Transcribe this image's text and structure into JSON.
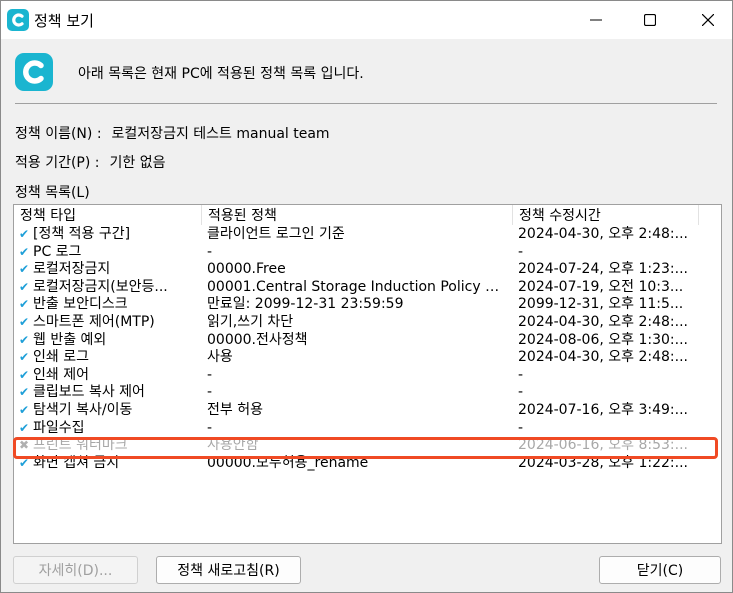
{
  "window": {
    "title": "정책 보기"
  },
  "intro": "아래 목록은 현재 PC에 적용된 정책 목록 입니다.",
  "fields": {
    "name_label": "정책 이름(N) :",
    "name_value": "로컬저장금지 테스트 manual team",
    "period_label": "적용 기간(P) :",
    "period_value": "기한 없음",
    "list_label": "정책 목록(L)"
  },
  "list": {
    "columns": [
      "정책 타입",
      "적용된 정책",
      "정책 수정시간"
    ],
    "rows": [
      {
        "type": "[정책 적용 구간]",
        "applied": "클라이언트 로그인 기준",
        "modified": "2024-04-30, 오후 2:48:...",
        "enabled": true
      },
      {
        "type": "PC 로그",
        "applied": "-",
        "modified": "-",
        "enabled": true
      },
      {
        "type": "로컬저장금지",
        "applied": "00000.Free",
        "modified": "2024-07-24, 오후 1:23:...",
        "enabled": true
      },
      {
        "type": "로컬저장금지(보안등...",
        "applied": "00001.Central Storage Induction Policy de...",
        "modified": "2024-07-19, 오전 10:3...",
        "enabled": true
      },
      {
        "type": "반출 보안디스크",
        "applied": "만료일: 2099-12-31 23:59:59",
        "modified": "2099-12-31, 오후 11:5...",
        "enabled": true
      },
      {
        "type": "스마트폰 제어(MTP)",
        "applied": "읽기,쓰기 차단",
        "modified": "2024-04-30, 오후 2:48:...",
        "enabled": true
      },
      {
        "type": "웹 반출 예외",
        "applied": "00000.전사정책",
        "modified": "2024-08-06, 오후 1:30:...",
        "enabled": true
      },
      {
        "type": "인쇄 로그",
        "applied": "사용",
        "modified": "2024-04-30, 오후 2:48:...",
        "enabled": true
      },
      {
        "type": "인쇄 제어",
        "applied": "-",
        "modified": "-",
        "enabled": true
      },
      {
        "type": "클립보드 복사 제어",
        "applied": "-",
        "modified": "-",
        "enabled": true
      },
      {
        "type": "탐색기 복사/이동",
        "applied": "전부 허용",
        "modified": "2024-07-16, 오후 3:49:...",
        "enabled": true
      },
      {
        "type": "파일수집",
        "applied": "-",
        "modified": "-",
        "enabled": true
      },
      {
        "type": "프린트 워터마크",
        "applied": "사용안함",
        "modified": "2024-06-16, 오후 8:53:...",
        "enabled": false
      },
      {
        "type": "화면 캡쳐 금지",
        "applied": "00000.모두허용_rename",
        "modified": "2024-03-28, 오후 1:22:...",
        "enabled": true
      }
    ]
  },
  "buttons": {
    "details": "자세히(D)...",
    "refresh": "정책 새로고침(R)",
    "close": "닫기(C)"
  },
  "icons": {
    "check": "✔",
    "cross": "✖"
  },
  "colors": {
    "accent": "#1ab5d0",
    "check": "#1e9fd8",
    "highlight": "#f04a24"
  }
}
